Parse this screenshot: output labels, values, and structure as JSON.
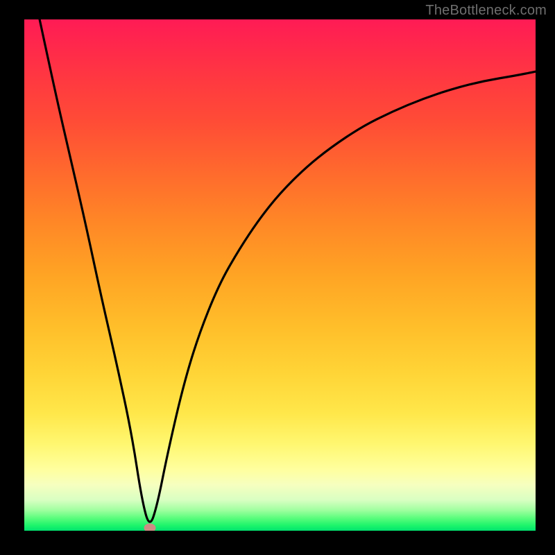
{
  "watermark": "TheBottleneck.com",
  "chart_data": {
    "type": "line",
    "title": "",
    "xlabel": "",
    "ylabel": "",
    "xlim": [
      0,
      100
    ],
    "ylim": [
      0,
      100
    ],
    "grid": false,
    "series": [
      {
        "name": "bottleneck-curve",
        "x": [
          3,
          6,
          9,
          12,
          15,
          18,
          21,
          23,
          24.5,
          26,
          28,
          31,
          34,
          38,
          42,
          46,
          50,
          55,
          60,
          66,
          72,
          78,
          84,
          90,
          96,
          100
        ],
        "values": [
          100,
          86,
          73,
          60,
          46,
          33,
          19,
          6,
          0.5,
          5,
          15,
          28,
          38,
          48,
          55,
          61,
          66,
          71,
          75,
          79,
          82,
          84.5,
          86.5,
          88,
          89,
          89.8
        ]
      }
    ],
    "marker": {
      "x": 24.5,
      "y": 0.6,
      "color": "#cc8d84"
    },
    "background_gradient": {
      "stops": [
        {
          "pct": 0,
          "color": "#ff1b55"
        },
        {
          "pct": 50,
          "color": "#ffa424"
        },
        {
          "pct": 88,
          "color": "#ffff9e"
        },
        {
          "pct": 100,
          "color": "#00e36e"
        }
      ]
    }
  }
}
